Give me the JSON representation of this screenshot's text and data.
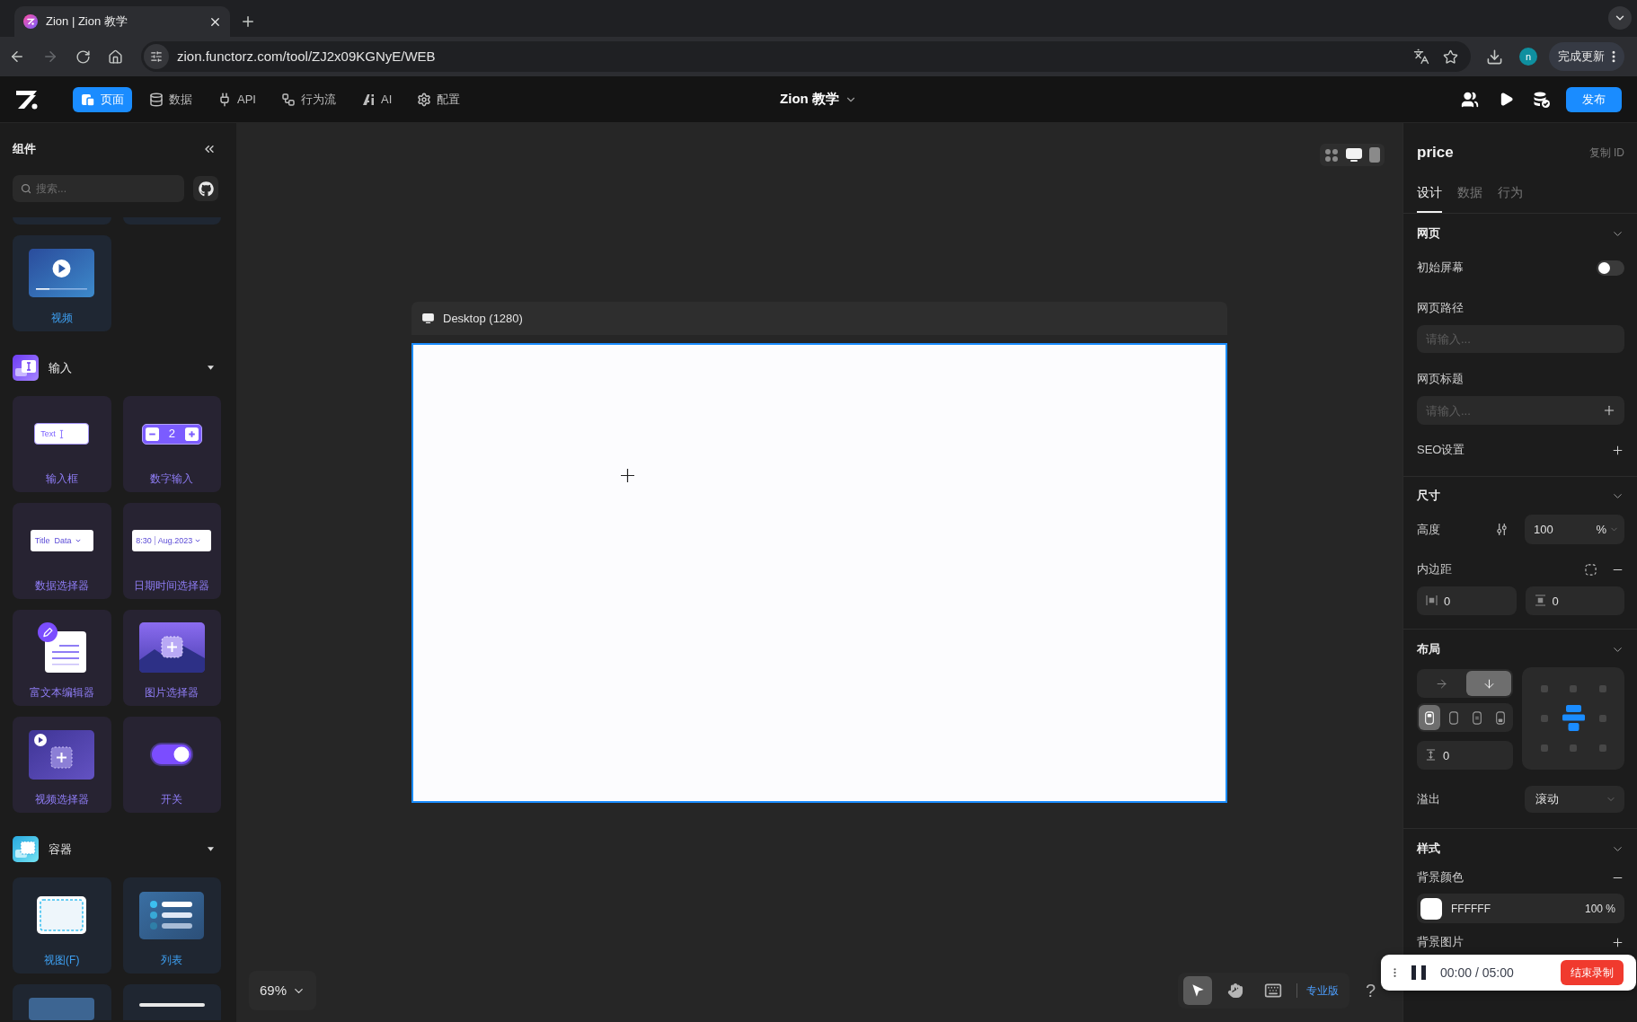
{
  "browser": {
    "tabs": [
      {
        "title": "Zion | Zion 教学",
        "selected": true
      }
    ],
    "back_disabled": false,
    "forward_disabled": true,
    "url": "zion.functorz.com/tool/ZJ2x09KGNyE/WEB",
    "profile_initial": "n",
    "update_button": "完成更新"
  },
  "app_header": {
    "nav": [
      {
        "label": "页面",
        "selected": true
      },
      {
        "label": "数据",
        "selected": false
      },
      {
        "label": "API",
        "selected": false
      },
      {
        "label": "行为流",
        "selected": false
      },
      {
        "label": "AI",
        "selected": false
      },
      {
        "label": "配置",
        "selected": false
      }
    ],
    "project_title": "Zion 教学",
    "publish_button": "发布"
  },
  "component_panel": {
    "title": "组件",
    "search": {
      "placeholder": "搜索..."
    },
    "sections": [
      {
        "kind": "media",
        "items": [
          {
            "kind": "clipped_top"
          },
          {
            "kind": "clipped_top"
          },
          {
            "kind": "video",
            "label": "视频"
          }
        ]
      },
      {
        "kind": "input",
        "title": "输入",
        "items": [
          {
            "kind": "text_input",
            "label": "输入框",
            "sample": "Text"
          },
          {
            "kind": "number_input",
            "label": "数字输入",
            "sample": "2"
          },
          {
            "kind": "data_select",
            "label": "数据选择器",
            "sample_title": "Title",
            "sample_value": "Data"
          },
          {
            "kind": "datetime_picker",
            "label": "日期时间选择器",
            "sample_time": "8:30",
            "sample_date": "Aug.2023"
          },
          {
            "kind": "rich_text",
            "label": "富文本编辑器"
          },
          {
            "kind": "image_picker",
            "label": "图片选择器"
          },
          {
            "kind": "video_picker",
            "label": "视频选择器"
          },
          {
            "kind": "switch",
            "label": "开关"
          }
        ]
      },
      {
        "kind": "container",
        "title": "容器",
        "items": [
          {
            "kind": "view",
            "label": "视图(F)"
          },
          {
            "kind": "list",
            "label": "列表"
          },
          {
            "kind": "clipped_bottom"
          },
          {
            "kind": "clipped_bottom"
          }
        ]
      }
    ]
  },
  "canvas": {
    "device_modes": [
      {
        "selected": false
      },
      {
        "selected": true
      },
      {
        "selected": false
      }
    ],
    "artboard": {
      "label": "Desktop (1280)"
    },
    "zoom": "69%",
    "tools": [
      {
        "selected": true
      },
      {
        "selected": false
      },
      {
        "selected": false
      }
    ],
    "plan_label": "专业版",
    "help": "?"
  },
  "inspector": {
    "title": "price",
    "copy_id": "复制 ID",
    "tabs": [
      {
        "label": "设计",
        "selected": true
      },
      {
        "label": "数据",
        "selected": false
      },
      {
        "label": "行为",
        "selected": false
      }
    ],
    "page_section": {
      "title": "网页",
      "initial_screen": {
        "label": "初始屏幕",
        "on": false
      },
      "path": {
        "label": "网页路径",
        "placeholder": "请输入..."
      },
      "page_title": {
        "label": "网页标题",
        "placeholder": "请输入..."
      },
      "seo": {
        "label": "SEO设置"
      }
    },
    "size_section": {
      "title": "尺寸",
      "height": {
        "label": "高度",
        "value": "100",
        "unit": "%"
      },
      "padding": {
        "label": "内边距",
        "horizontal": "0",
        "vertical": "0"
      }
    },
    "layout_section": {
      "title": "布局",
      "directions": [
        {
          "selected": false
        },
        {
          "selected": true
        }
      ],
      "alignments": [
        {
          "selected": true
        },
        {
          "selected": false
        },
        {
          "selected": false
        },
        {
          "selected": false
        }
      ],
      "gap": "0",
      "align_grid": [
        {
          "selected": false
        },
        {
          "selected": false
        },
        {
          "selected": false
        },
        {
          "selected": false
        },
        {
          "selected": true
        },
        {
          "selected": false
        },
        {
          "selected": false
        },
        {
          "selected": false
        },
        {
          "selected": false
        }
      ],
      "overflow": {
        "label": "溢出",
        "value": "滚动"
      }
    },
    "style_section": {
      "title": "样式",
      "background_color": {
        "label": "背景颜色",
        "hex": "FFFFFF",
        "opacity": "100 %",
        "color": "#ffffff"
      },
      "background_image": {
        "label": "背景图片"
      }
    }
  },
  "recording_bar": {
    "timer": "00:00 / 05:00",
    "stop_button": "结束录制"
  }
}
